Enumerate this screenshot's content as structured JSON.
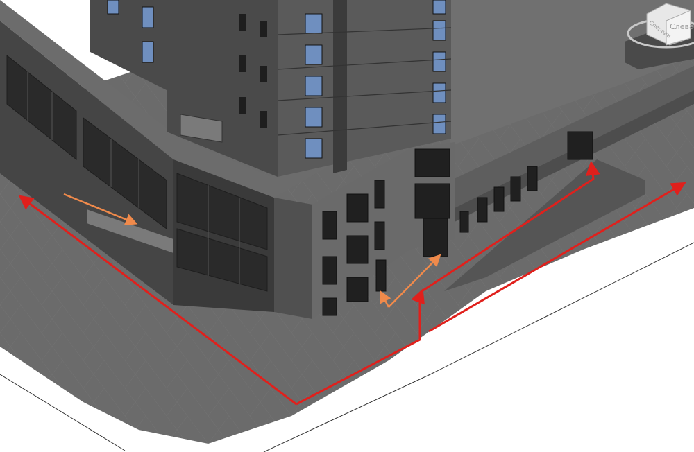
{
  "viewcube": {
    "face_left": "Слева",
    "face_front": "Спереди"
  },
  "colors": {
    "background": "#ffffff",
    "ground": "#6b6b6b",
    "ground_dark": "#5a5a5a",
    "building_dark": "#3f3f3f",
    "building_mid": "#575757",
    "building_light": "#6e6e6e",
    "window_blue": "#6f8fbf",
    "window_dark": "#202020",
    "route_primary": "#e0201c",
    "route_secondary": "#f08a4b"
  },
  "icons": [
    "viewcube-icon",
    "arrowhead-icon"
  ]
}
